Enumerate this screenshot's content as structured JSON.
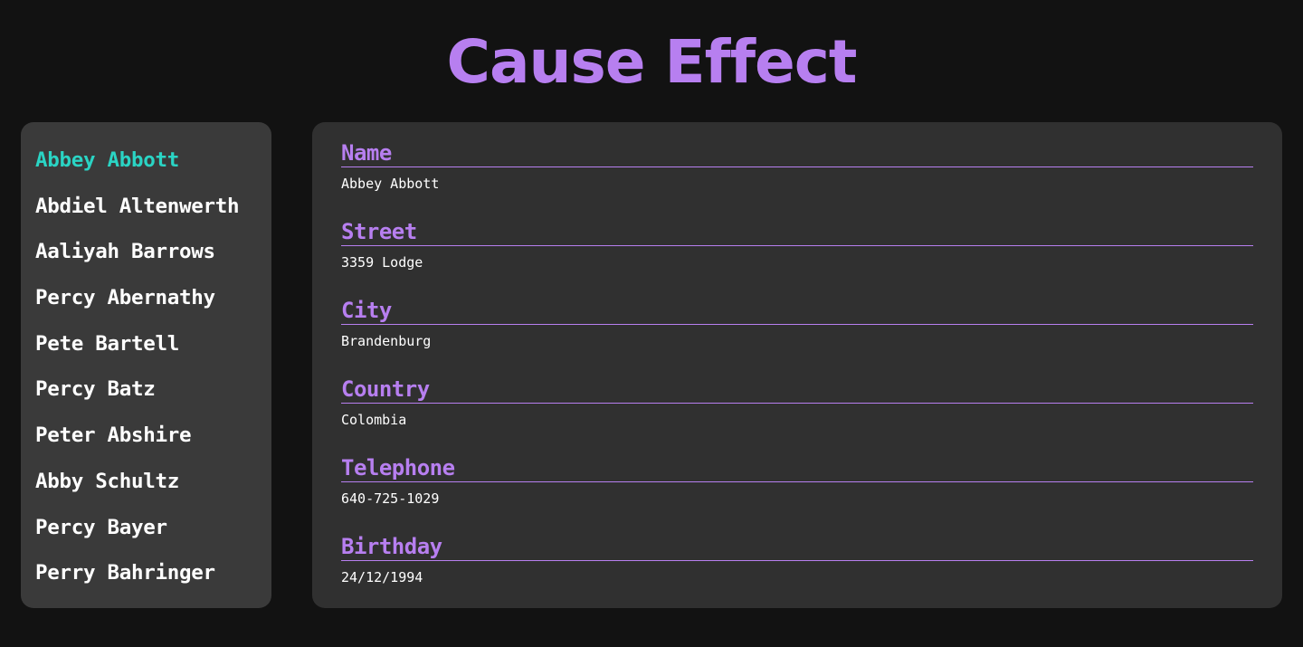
{
  "app": {
    "title": "Cause Effect"
  },
  "colors": {
    "accent": "#b77ff0",
    "active": "#2ad4c4",
    "background": "#121212",
    "sidebar_bg": "#3a3a3a",
    "panel_bg": "#303030"
  },
  "sidebar": {
    "items": [
      {
        "label": "Abbey Abbott",
        "active": true
      },
      {
        "label": "Abdiel Altenwerth",
        "active": false
      },
      {
        "label": "Aaliyah Barrows",
        "active": false
      },
      {
        "label": "Percy Abernathy",
        "active": false
      },
      {
        "label": "Pete Bartell",
        "active": false
      },
      {
        "label": "Percy Batz",
        "active": false
      },
      {
        "label": "Peter Abshire",
        "active": false
      },
      {
        "label": "Abby Schultz",
        "active": false
      },
      {
        "label": "Percy Bayer",
        "active": false
      },
      {
        "label": "Perry Bahringer",
        "active": false
      }
    ]
  },
  "detail": {
    "fields": [
      {
        "label": "Name",
        "value": "Abbey Abbott"
      },
      {
        "label": "Street",
        "value": "3359 Lodge"
      },
      {
        "label": "City",
        "value": "Brandenburg"
      },
      {
        "label": "Country",
        "value": "Colombia"
      },
      {
        "label": "Telephone",
        "value": "640-725-1029"
      },
      {
        "label": "Birthday",
        "value": "24/12/1994"
      }
    ]
  }
}
